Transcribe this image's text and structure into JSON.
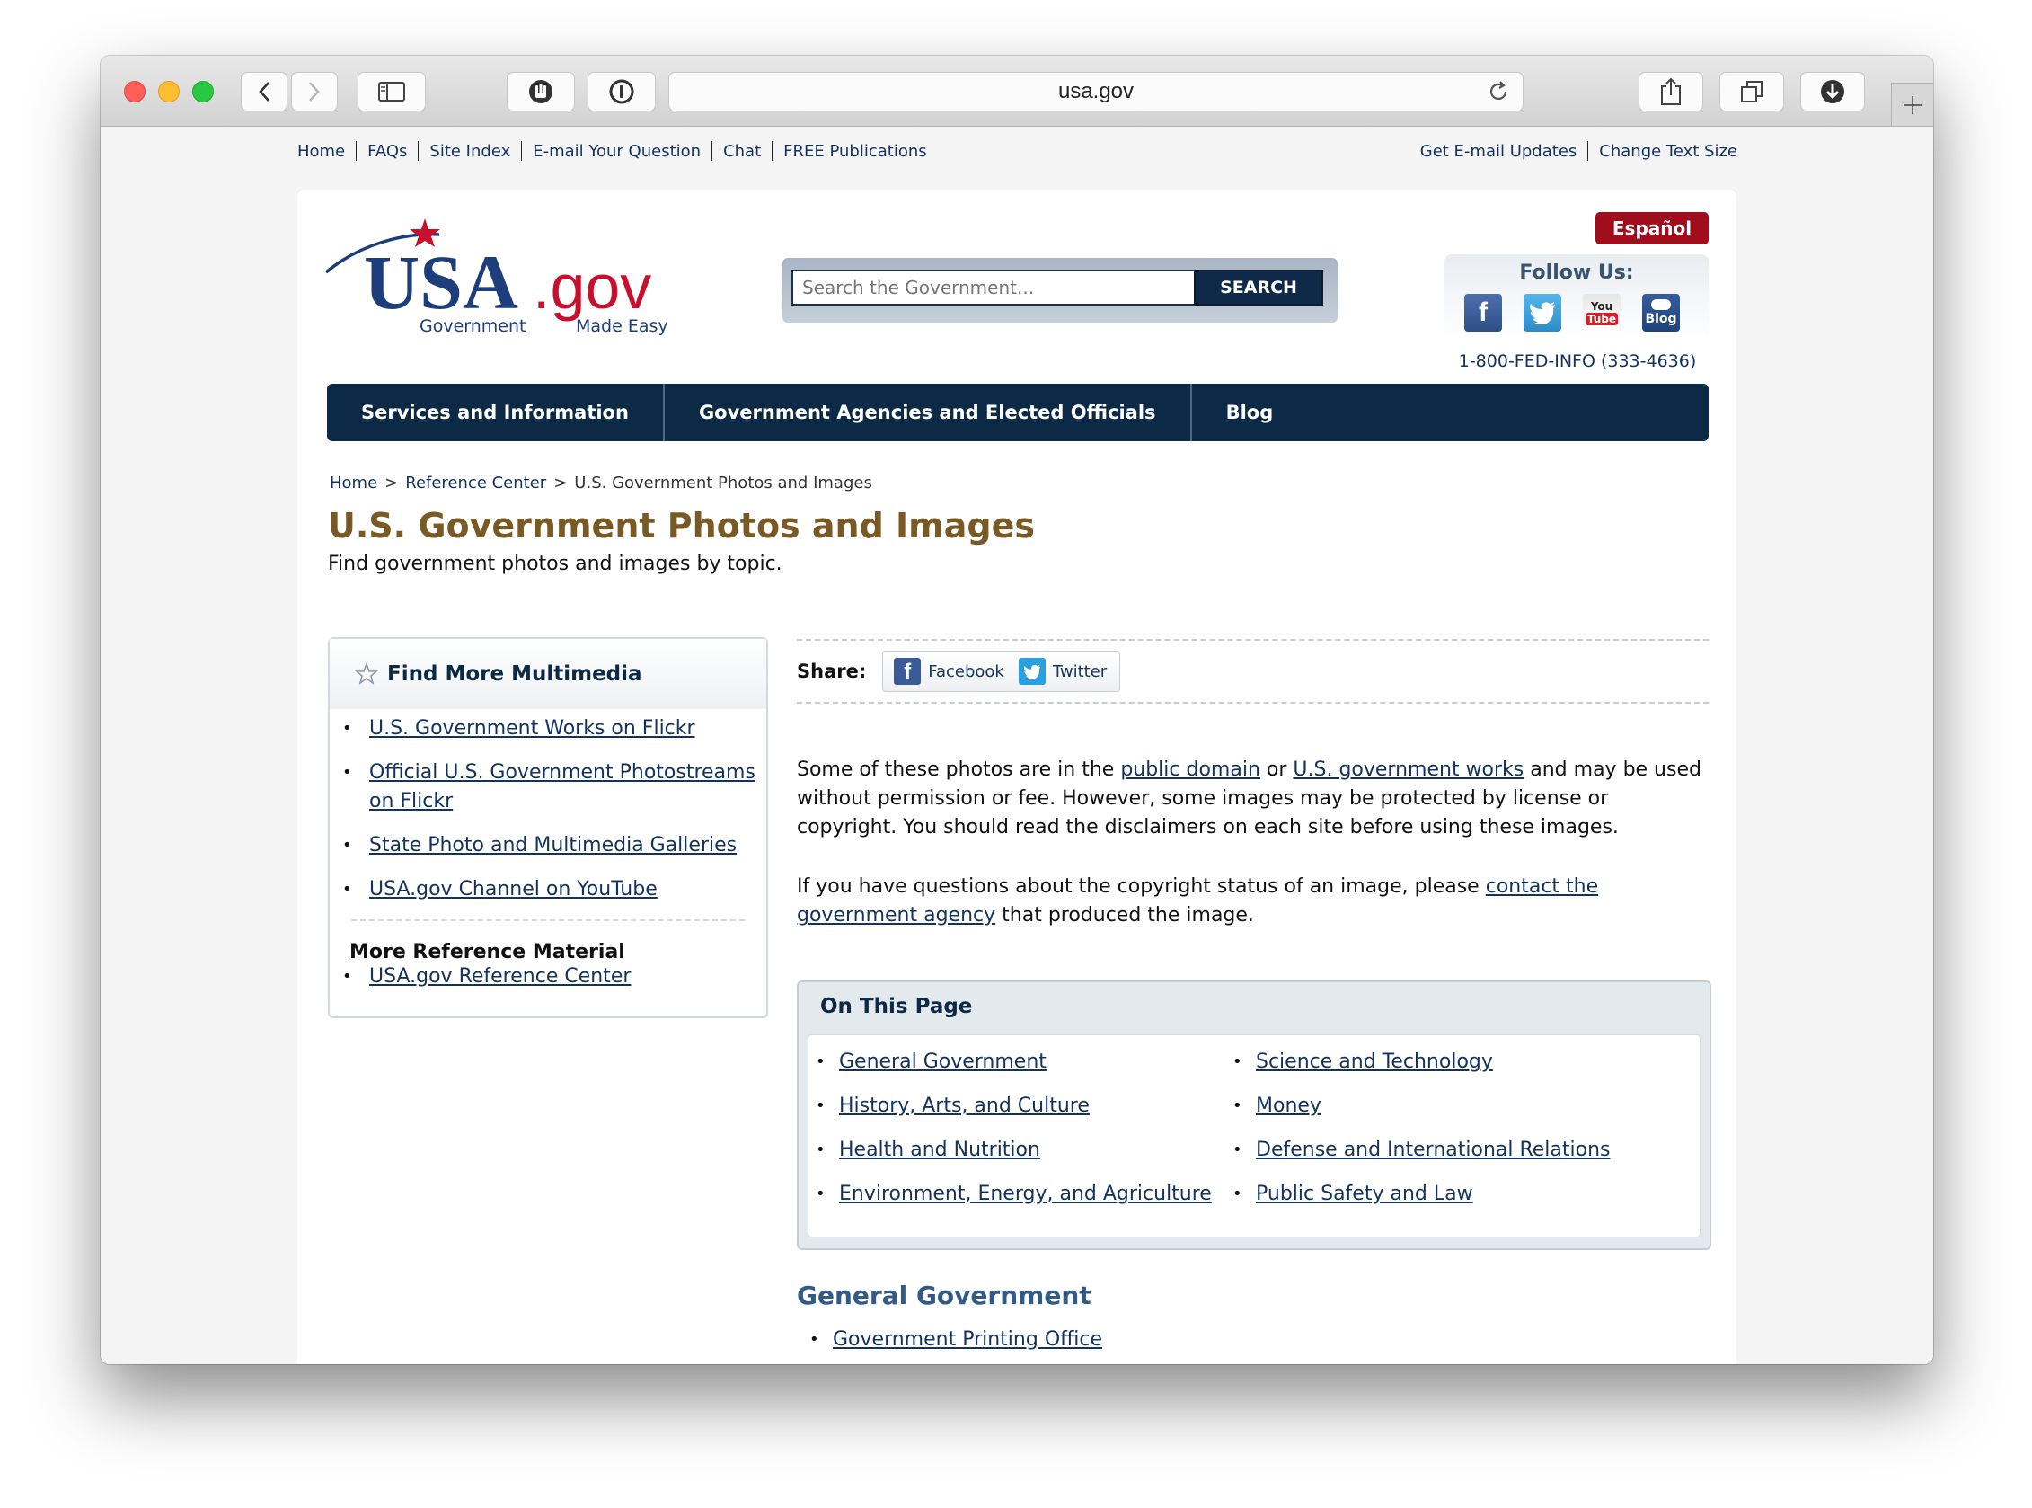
{
  "browser": {
    "url": "usa.gov"
  },
  "utility_nav": {
    "left": [
      "Home",
      "FAQs",
      "Site Index",
      "E-mail Your Question",
      "Chat",
      "FREE Publications"
    ],
    "right": [
      "Get E-mail Updates",
      "Change Text Size"
    ]
  },
  "header": {
    "logo_main": "USA",
    "logo_gov": ".gov",
    "logo_tag1": "Government",
    "logo_tag2": "Made Easy",
    "search_placeholder": "Search the Government...",
    "search_button": "SEARCH",
    "espanol": "Español",
    "follow_title": "Follow Us:",
    "social": {
      "facebook": "f",
      "youtube_top": "You",
      "youtube_bottom": "Tube",
      "blog": "Blog"
    },
    "phone": "1-800-FED-INFO (333-4636)"
  },
  "main_nav": [
    "Services and Information",
    "Government Agencies and Elected Officials",
    "Blog"
  ],
  "breadcrumb": {
    "home": "Home",
    "sep": ">",
    "ref": "Reference Center",
    "current": "U.S. Government Photos and Images"
  },
  "page": {
    "title": "U.S. Government Photos and Images",
    "subtitle": "Find government photos and images by topic."
  },
  "sidebar": {
    "heading": "Find More Multimedia",
    "links": [
      "U.S. Government Works on Flickr",
      "Official U.S. Government Photostreams on Flickr",
      "State Photo and Multimedia Galleries",
      "USA.gov Channel on YouTube"
    ],
    "more_heading": "More Reference Material",
    "more_links": [
      "USA.gov Reference Center"
    ]
  },
  "share": {
    "label": "Share:",
    "facebook": "Facebook",
    "twitter": "Twitter"
  },
  "content": {
    "p1_a": "Some of these photos are in the ",
    "p1_link1": "public domain",
    "p1_b": " or ",
    "p1_link2": "U.S. government works",
    "p1_c": " and may be used without permission or fee. However, some images may be protected by license or copyright. You should read the disclaimers on each site before using these images.",
    "p2_a": "If you have questions about the copyright status of an image, please ",
    "p2_link": "contact the government agency",
    "p2_b": " that produced the image."
  },
  "on_this_page": {
    "title": "On This Page",
    "col1": [
      "General Government",
      "History, Arts, and Culture",
      "Health and Nutrition",
      "Environment, Energy, and Agriculture"
    ],
    "col2": [
      "Science and Technology",
      "Money",
      "Defense and International Relations",
      "Public Safety and Law"
    ]
  },
  "section": {
    "heading": "General Government",
    "items": [
      "Government Printing Office"
    ]
  },
  "bullet": "•",
  "colors": {
    "nav_bg": "#0c2a45",
    "title_brown": "#7a5a24",
    "link_blue": "#13335e",
    "espanol_red": "#a00d1d",
    "section_blue": "#325a86"
  }
}
